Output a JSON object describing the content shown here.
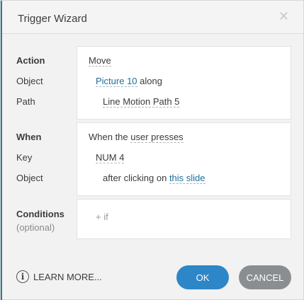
{
  "dialog": {
    "title": "Trigger Wizard",
    "close_glyph": "✕"
  },
  "action_section": {
    "labels": [
      "Action",
      "Object",
      "Path"
    ],
    "action_value": "Move",
    "object_value": "Picture 10",
    "object_suffix": " along",
    "path_value": "Line Motion Path 5"
  },
  "when_section": {
    "labels": [
      "When",
      "Key",
      "Object"
    ],
    "when_prefix": "When the ",
    "when_value": "user presses",
    "key_value": "NUM 4",
    "object_prefix": "after clicking on ",
    "object_value": "this slide"
  },
  "conditions_section": {
    "label": "Conditions",
    "sublabel": "(optional)",
    "add_if": "+ if"
  },
  "footer": {
    "info_icon": "i",
    "learn_more": "LEARN MORE...",
    "ok": "OK",
    "cancel": "CANCEL"
  },
  "colors": {
    "accent": "#2d86c8",
    "link": "#1f6f9b",
    "cancel": "#8b8e91"
  }
}
